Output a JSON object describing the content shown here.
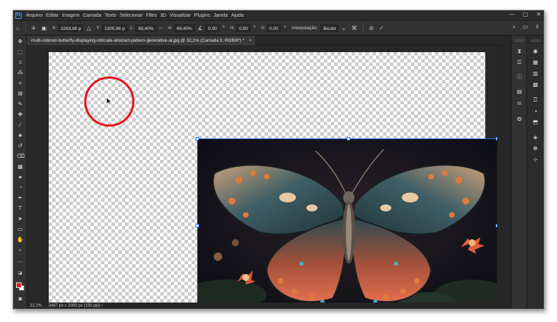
{
  "app": {
    "logo": "Ps"
  },
  "menu": [
    "Arquivo",
    "Editar",
    "Imagem",
    "Camada",
    "Texto",
    "Selecionar",
    "Filtro",
    "3D",
    "Visualizar",
    "Plugins",
    "Janela",
    "Ajuda"
  ],
  "window_controls": {
    "minimize": "—",
    "maximize": "▢",
    "close": "✕"
  },
  "options": {
    "x_label": "X:",
    "x_value": "2263,88 p",
    "y_label": "Y:",
    "y_value": "1305,96 p",
    "w_label": "L:",
    "w_value": "69,40%",
    "h_label": "A:",
    "h_value": "69,40%",
    "angle_value": "0,00",
    "hskew_label": "H:",
    "hskew_value": "0,00",
    "vskew_label": "V:",
    "vskew_value": "0,00",
    "interp_label": "Interpolação:",
    "interp_value": "Bicúbi"
  },
  "document": {
    "tab_title": "multi-colored-butterfly-displaying-intricate-abstract-pattern-generative-ai.jpg @ 32,2% (Camada 0, RGB/8*) *",
    "close": "×"
  },
  "status": {
    "zoom": "32,2%",
    "info": "3467 px x 2000 px (150 ppi)",
    "arrow": "›"
  },
  "colors": {
    "foreground": "#e61e1e",
    "background": "#ffffff",
    "cursor_ring": "#e60f1a",
    "transform_box": "#2a6cf0"
  },
  "icons": {
    "tools": [
      "move-tool-icon",
      "marquee-tool-icon",
      "lasso-tool-icon",
      "magic-wand-icon",
      "crop-tool-icon",
      "frame-tool-icon",
      "eyedropper-icon",
      "healing-brush-icon",
      "brush-tool-icon",
      "clone-stamp-icon",
      "history-brush-icon",
      "eraser-icon",
      "gradient-icon",
      "blur-icon",
      "dodge-icon",
      "pen-tool-icon",
      "type-tool-icon",
      "path-selection-icon",
      "shape-tool-icon",
      "hand-tool-icon",
      "zoom-tool-icon",
      "more-tools-icon"
    ],
    "panels": [
      "history-icon",
      "properties-icon",
      "info-icon",
      "libraries-icon",
      "adjustments-icon",
      "color-icon",
      "swatches-icon",
      "gradients-icon",
      "patterns-icon",
      "layers-icon",
      "channels-icon",
      "paths-icon"
    ]
  }
}
